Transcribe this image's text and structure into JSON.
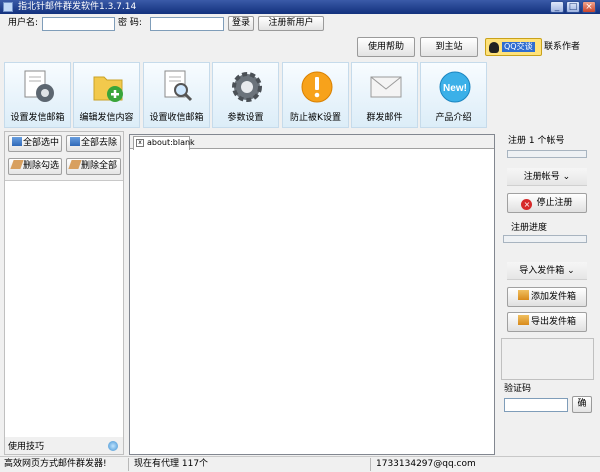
{
  "window": {
    "title": "指北针邮件群发软件1.3.7.14"
  },
  "login": {
    "username_label": "用户名:",
    "password_label": "密  码:",
    "username_value": "",
    "password_value": "",
    "login_button": "登录",
    "register_button": "注册新用户"
  },
  "topbar": {
    "help_button": "使用帮助",
    "site_button": "到主站",
    "qq_badge": "QQ交谈",
    "contact_label": "联系作者"
  },
  "toolbar": [
    {
      "label": "设置发信邮箱",
      "icon": "gear-document-icon"
    },
    {
      "label": "编辑发信内容",
      "icon": "folder-add-icon"
    },
    {
      "label": "设置收信邮箱",
      "icon": "document-search-icon"
    },
    {
      "label": "参数设置",
      "icon": "gear-icon"
    },
    {
      "label": "防止被K设置",
      "icon": "warning-icon"
    },
    {
      "label": "群发邮件",
      "icon": "envelope-icon"
    },
    {
      "label": "产品介绍",
      "icon": "new-badge-icon"
    }
  ],
  "left_panel": {
    "select_all": "全部选中",
    "deselect_all": "全部去除",
    "delete_checked": "删除勾选",
    "delete_all": "删除全部",
    "tips_label": "使用技巧"
  },
  "browser": {
    "tab_label": "about:blank",
    "tab_close": "x"
  },
  "right_panel": {
    "register_count": "注册 1 个帐号",
    "register_progress_value": 0.0,
    "account_section": "注册帐号",
    "stop_register_button": "停止注册",
    "register_progress_label": "注册进度",
    "progress_value": 0.0,
    "import_section": "导入发件箱",
    "add_outbox_button": "添加发件箱",
    "export_outbox_button": "导出发件箱",
    "captcha_label": "验证码",
    "captcha_value": "",
    "captcha_confirm": "确"
  },
  "status_bar": {
    "slogan": "高效网页方式邮件群发器!",
    "proxy_count": "现在有代理 117个",
    "contact_email": "1733134297@qq.com"
  }
}
